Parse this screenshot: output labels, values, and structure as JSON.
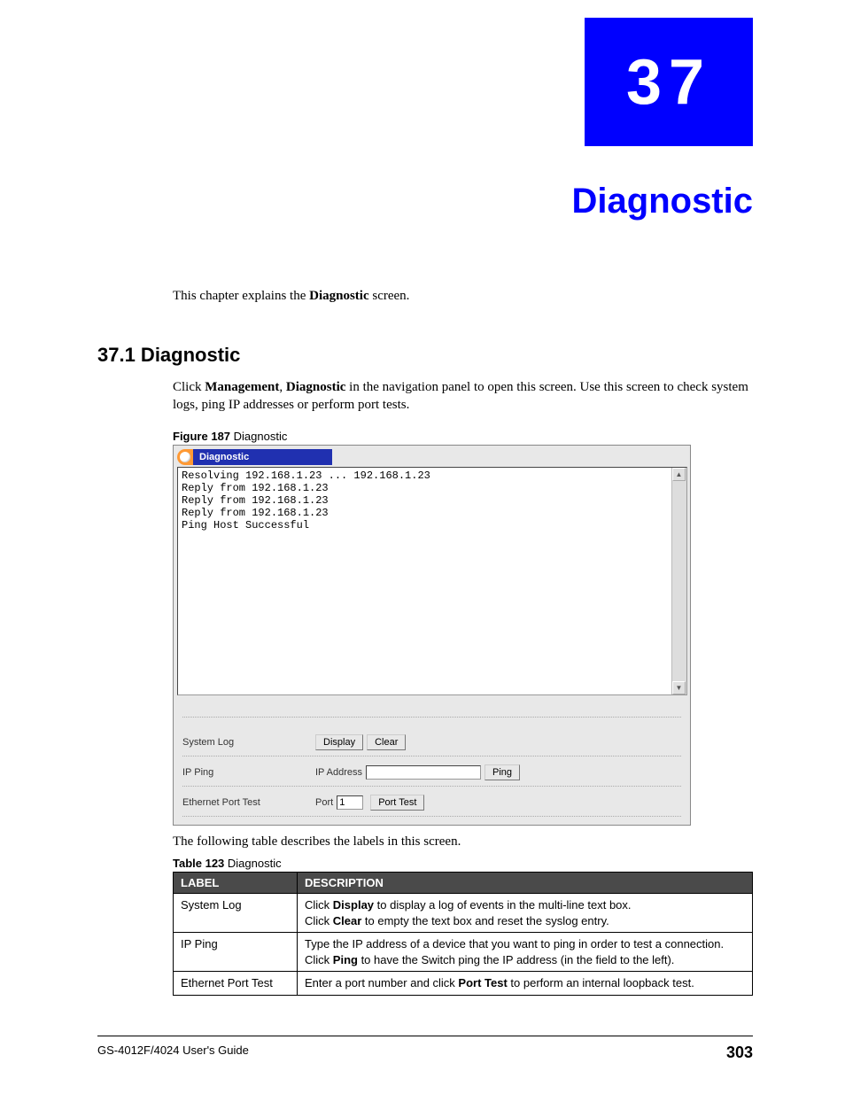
{
  "chapter": {
    "number": "37",
    "title": "Diagnostic"
  },
  "intro": {
    "prefix": "This chapter explains the ",
    "bold": "Diagnostic",
    "suffix": " screen."
  },
  "section": {
    "heading": "37.1  Diagnostic",
    "body_parts": {
      "p1a": "Click ",
      "p1b": "Management",
      "p1c": ", ",
      "p1d": "Diagnostic",
      "p1e": " in the navigation panel to open this screen. Use this screen to check system logs, ping IP addresses or perform port tests."
    }
  },
  "figure": {
    "caption_label": "Figure 187",
    "caption_text": "   Diagnostic",
    "header": "Diagnostic",
    "log_lines": "Resolving 192.168.1.23 ... 192.168.1.23\nReply from 192.168.1.23\nReply from 192.168.1.23\nReply from 192.168.1.23\nPing Host Successful",
    "rows": {
      "syslog": {
        "label": "System Log",
        "btn_display": "Display",
        "btn_clear": "Clear"
      },
      "ipping": {
        "label": "IP Ping",
        "field_label": "IP Address",
        "value": "",
        "btn_ping": "Ping"
      },
      "porttest": {
        "label": "Ethernet Port Test",
        "field_label": "Port",
        "value": "1",
        "btn_test": "Port Test"
      }
    }
  },
  "after_figure": "The following table describes the labels in this screen.",
  "table": {
    "caption_label": "Table 123",
    "caption_text": "   Diagnostic",
    "headers": {
      "col1": "LABEL",
      "col2": "DESCRIPTION"
    },
    "rows": [
      {
        "label": "System Log",
        "desc_parts": [
          {
            "t": "Click ",
            "b": false
          },
          {
            "t": "Display",
            "b": true
          },
          {
            "t": " to display a log of events in the multi-line text box.",
            "b": false
          },
          {
            "br": true
          },
          {
            "t": "Click ",
            "b": false
          },
          {
            "t": "Clear",
            "b": true
          },
          {
            "t": " to empty the text box and reset the syslog entry.",
            "b": false
          }
        ]
      },
      {
        "label": "IP Ping",
        "desc_parts": [
          {
            "t": "Type the IP address of a device that you want to ping in order to test a connection.",
            "b": false
          },
          {
            "br": true
          },
          {
            "t": "Click ",
            "b": false
          },
          {
            "t": "Ping",
            "b": true
          },
          {
            "t": " to have the Switch ping the IP address (in the field to the left).",
            "b": false
          }
        ]
      },
      {
        "label": "Ethernet Port Test",
        "desc_parts": [
          {
            "t": "Enter a port number and click ",
            "b": false
          },
          {
            "t": "Port Test",
            "b": true
          },
          {
            "t": " to perform an internal loopback test.",
            "b": false
          }
        ]
      }
    ]
  },
  "footer": {
    "left": "GS-4012F/4024 User's Guide",
    "right": "303"
  }
}
